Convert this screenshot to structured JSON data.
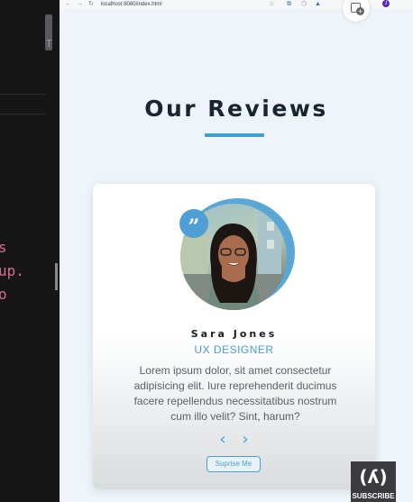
{
  "editor": {
    "scroll_marker": "T",
    "code_lines": [
      "s",
      "up.",
      "o"
    ]
  },
  "browser": {
    "nav": {
      "back": "←",
      "forward": "→",
      "reload": "↻"
    },
    "url": "localhost:8080/index.html",
    "toolbar_icons": [
      "star-icon",
      "translate-icon",
      "extension-icon",
      "drive-icon",
      "account-icon"
    ],
    "profile_initial": "J"
  },
  "page": {
    "heading": "Our Reviews",
    "card": {
      "quote_mark": "”",
      "name": "Sara Jones",
      "role": "UX DESIGNER",
      "review": "Lorem ipsum dolor, sit amet consectetur adipisicing elit. Iure reprehenderit ducimus facere repellendus necessitatibus nostrum cum illo velit? Sint, harum?",
      "prev_arrow": "‹",
      "next_arrow": "›",
      "surprise_label": "Suprise Me"
    }
  },
  "overlay": {
    "subscribe_icon": "(ʎ)",
    "subscribe_label": "SUBSCRIBE"
  },
  "colors": {
    "accent": "#4b9fd4",
    "heading": "#1b2530",
    "background": "#eef4fa"
  }
}
